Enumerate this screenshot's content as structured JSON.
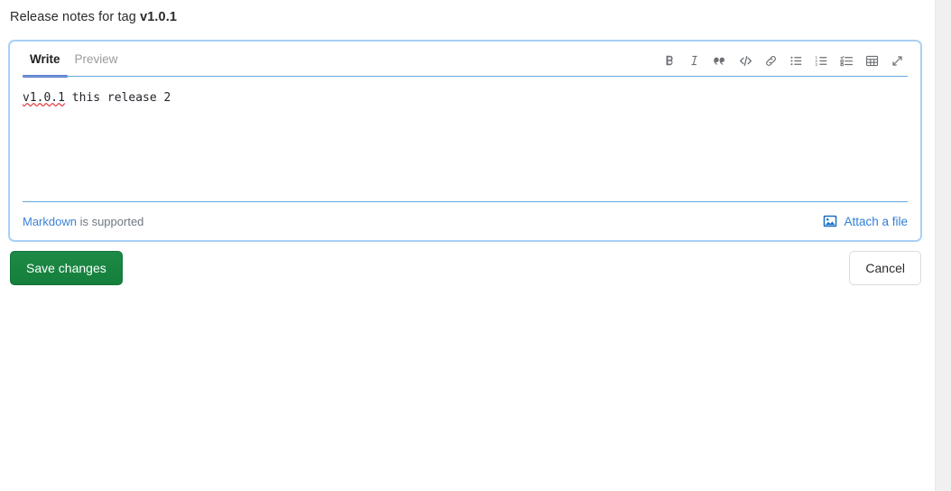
{
  "header": {
    "title_prefix": "Release notes for tag ",
    "tag_name": "v1.0.1"
  },
  "editor": {
    "tabs": [
      {
        "label": "Write",
        "active": true,
        "name": "tab-write"
      },
      {
        "label": "Preview",
        "active": false,
        "name": "tab-preview"
      }
    ],
    "toolbar": [
      {
        "name": "bold-icon",
        "label": "Bold"
      },
      {
        "name": "italic-icon",
        "label": "Italic"
      },
      {
        "name": "quote-icon",
        "label": "Insert a quote"
      },
      {
        "name": "code-icon",
        "label": "Insert code"
      },
      {
        "name": "link-icon",
        "label": "Add a link"
      },
      {
        "name": "bulleted-list-icon",
        "label": "Add a bulleted list"
      },
      {
        "name": "numbered-list-icon",
        "label": "Add a numbered list"
      },
      {
        "name": "task-list-icon",
        "label": "Add a task list"
      },
      {
        "name": "table-icon",
        "label": "Add a table"
      },
      {
        "name": "fullscreen-icon",
        "label": "Go full screen"
      }
    ],
    "content": {
      "misspelled_word": "v1.0.1",
      "rest": " this release 2"
    },
    "placeholder": "",
    "footer": {
      "markdown_link": "Markdown",
      "markdown_suffix": " is supported",
      "attach_label": "Attach a file",
      "attach_icon": "image-icon"
    }
  },
  "actions": {
    "save_label": "Save changes",
    "cancel_label": "Cancel"
  },
  "colors": {
    "focus_ring": "#a8d1f5",
    "divider_blue": "#64a7e0",
    "active_tab_underline": "#6575c9",
    "link_blue": "#2f7fd6",
    "save_green": "#157f3c",
    "spellcheck_red": "#e5484d"
  }
}
